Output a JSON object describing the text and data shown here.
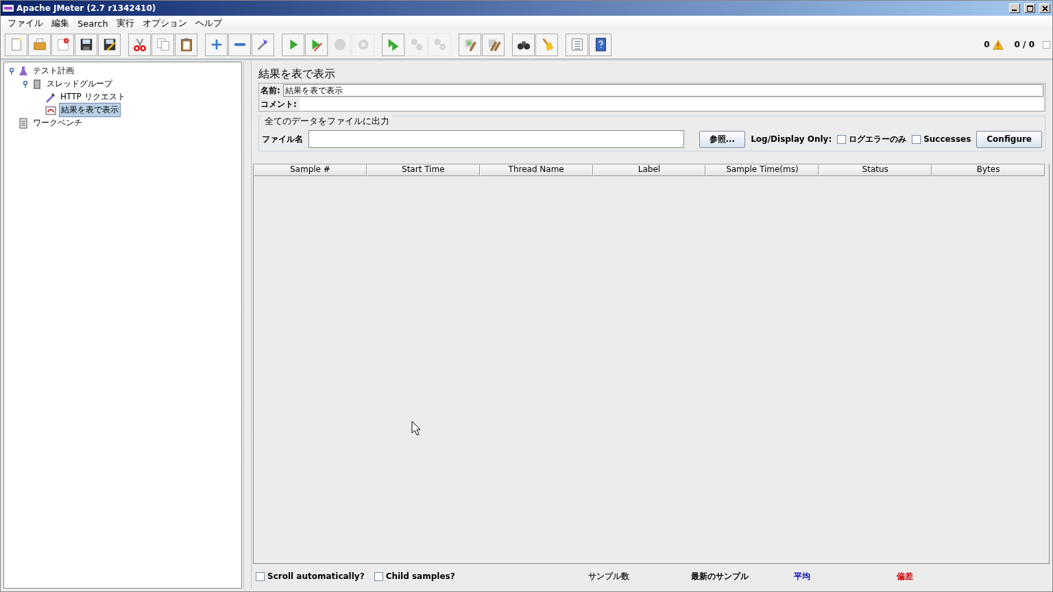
{
  "window": {
    "title": "Apache JMeter (2.7 r1342410)"
  },
  "menu": [
    "ファイル",
    "編集",
    "Search",
    "実行",
    "オプション",
    "ヘルプ"
  ],
  "toolbar": [
    {
      "kind": "new",
      "disabled": false
    },
    {
      "kind": "open",
      "disabled": false
    },
    {
      "kind": "close",
      "disabled": false
    },
    {
      "kind": "save",
      "disabled": false
    },
    {
      "kind": "saveas",
      "disabled": false
    },
    {
      "kind": "sep"
    },
    {
      "kind": "cut",
      "disabled": false
    },
    {
      "kind": "copy",
      "disabled": false
    },
    {
      "kind": "paste",
      "disabled": false
    },
    {
      "kind": "sep"
    },
    {
      "kind": "expand",
      "disabled": false
    },
    {
      "kind": "collapse",
      "disabled": false
    },
    {
      "kind": "toggle",
      "disabled": false
    },
    {
      "kind": "sep"
    },
    {
      "kind": "start",
      "disabled": false
    },
    {
      "kind": "startnp",
      "disabled": false
    },
    {
      "kind": "stop",
      "disabled": true
    },
    {
      "kind": "shutdown",
      "disabled": true
    },
    {
      "kind": "sep"
    },
    {
      "kind": "remotestart",
      "disabled": false
    },
    {
      "kind": "remotestop",
      "disabled": true
    },
    {
      "kind": "remoteshutdown",
      "disabled": true
    },
    {
      "kind": "sep"
    },
    {
      "kind": "clear",
      "disabled": false
    },
    {
      "kind": "clearall",
      "disabled": false
    },
    {
      "kind": "sep"
    },
    {
      "kind": "search",
      "disabled": false
    },
    {
      "kind": "reset",
      "disabled": false
    },
    {
      "kind": "sep"
    },
    {
      "kind": "functions",
      "disabled": false
    },
    {
      "kind": "help",
      "disabled": false
    }
  ],
  "status": {
    "error_count": "0",
    "threads": "0 / 0"
  },
  "tree": [
    {
      "label": "テスト計画",
      "kind": "plan",
      "selected": false,
      "children": [
        {
          "label": "スレッドグループ",
          "kind": "threads",
          "selected": false,
          "children": [
            {
              "label": "HTTP リクエスト",
              "kind": "sampler",
              "selected": false
            },
            {
              "label": "結果を表で表示",
              "kind": "listener",
              "selected": true
            }
          ]
        }
      ]
    },
    {
      "label": "ワークベンチ",
      "kind": "workbench",
      "selected": false
    }
  ],
  "panel": {
    "title": "結果を表で表示",
    "name_label": "名前:",
    "name_value": "結果を表で表示",
    "comment_label": "コメント:",
    "file_group_title": "全てのデータをファイルに出力",
    "file_label": "ファイル名",
    "browse_button": "参照...",
    "log_label": "Log/Display Only:",
    "options": [
      {
        "label": "ログエラーのみ",
        "checked": false
      },
      {
        "label": "Successes",
        "checked": false
      }
    ],
    "configure_button": "Configure"
  },
  "table": {
    "columns": [
      "Sample #",
      "Start Time",
      "Thread Name",
      "Label",
      "Sample Time(ms)",
      "Status",
      "Bytes"
    ]
  },
  "footer": {
    "options": [
      {
        "label": "Scroll automatically?",
        "checked": false
      },
      {
        "label": "Child samples?",
        "checked": false
      }
    ],
    "stats": [
      {
        "label": "サンプル数",
        "color": "#333333"
      },
      {
        "label": "最新のサンプル",
        "color": "#000000"
      },
      {
        "label": "平均",
        "color": "#0000cc"
      },
      {
        "label": "偏差",
        "color": "#cc0000"
      }
    ]
  }
}
